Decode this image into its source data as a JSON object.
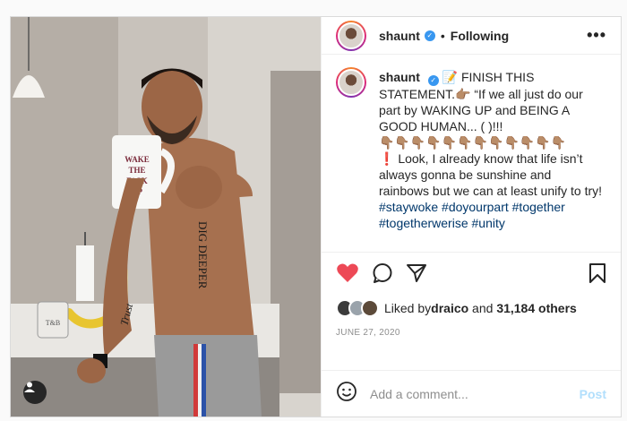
{
  "post": {
    "username": "shaunt",
    "separator": "•",
    "follow_status": "Following",
    "more_label": "•••"
  },
  "caption": {
    "username": "shaunt",
    "text_1": "📝 FINISH THIS STATEMENT.👉🏽 “If we all just do our part by WAKING UP and BEING A GOOD HUMAN... ( )!!!",
    "text_2": "👇🏽👇🏽👇🏽👇🏽👇🏽👇🏽👇🏽👇🏽👇🏽👇🏽👇🏽👇🏽",
    "text_3": "❗ Look, I already know that life isn’t always gonna be sunshine and rainbows but we can at least unify to try!",
    "hashtags": "#staywoke #doyourpart #together #togetherwerise #unity"
  },
  "photo": {
    "mug_text": "WAKE THE F*CK UP",
    "tattoo_side": "DIG DEEPER",
    "tattoo_arm": "Trust",
    "jar_text": "T&B"
  },
  "likes": {
    "prefix": "Liked by ",
    "user": "draico",
    "middle": " and ",
    "count": "31,184 others"
  },
  "date": "JUNE 27, 2020",
  "comment": {
    "placeholder": "Add a comment...",
    "post_label": "Post"
  },
  "icons": [
    "heart-icon",
    "comment-icon",
    "share-icon",
    "bookmark-icon",
    "emoji-icon",
    "user-tag-icon",
    "more-icon"
  ],
  "colors": {
    "like": "#ed4956",
    "verified": "#3897f0",
    "hashtag": "#00376b",
    "post_disabled": "#b2dffc"
  }
}
